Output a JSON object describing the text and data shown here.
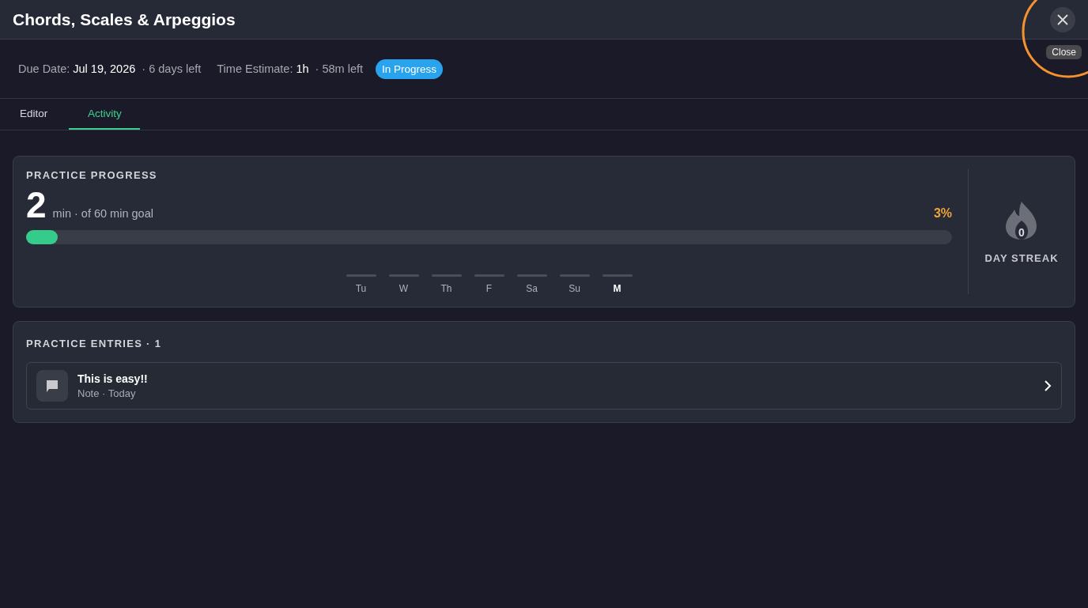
{
  "window": {
    "title": "Chords, Scales & Arpeggios",
    "close_tooltip": "Close"
  },
  "meta": {
    "due_label": "Due Date:",
    "due_value": "Jul 19, 2026",
    "due_left": "· 6 days left",
    "estimate_label": "Time Estimate:",
    "estimate_value": "1h",
    "estimate_left": "· 58m left",
    "status": "In Progress"
  },
  "tabs": [
    {
      "label": "Editor",
      "selected": false
    },
    {
      "label": "Activity",
      "selected": true
    }
  ],
  "progress": {
    "title": "PRACTICE PROGRESS",
    "minutes": "2",
    "goal": "min · of 60 min goal",
    "percent": "3%",
    "level": 0.033,
    "days": [
      {
        "label": "Tu",
        "selected": false,
        "level": 0
      },
      {
        "label": "W",
        "selected": false,
        "level": 0
      },
      {
        "label": "Th",
        "selected": false,
        "level": 0
      },
      {
        "label": "F",
        "selected": false,
        "level": 0
      },
      {
        "label": "Sa",
        "selected": false,
        "level": 0
      },
      {
        "label": "Su",
        "selected": false,
        "level": 0
      },
      {
        "label": "M",
        "selected": true,
        "level": 0
      }
    ],
    "streak": {
      "count": "0",
      "label": "DAY STREAK"
    }
  },
  "entries": {
    "title": "PRACTICE ENTRIES · 1",
    "items": [
      {
        "title": "This is easy!!",
        "subtitle": "Note · Today"
      }
    ]
  }
}
